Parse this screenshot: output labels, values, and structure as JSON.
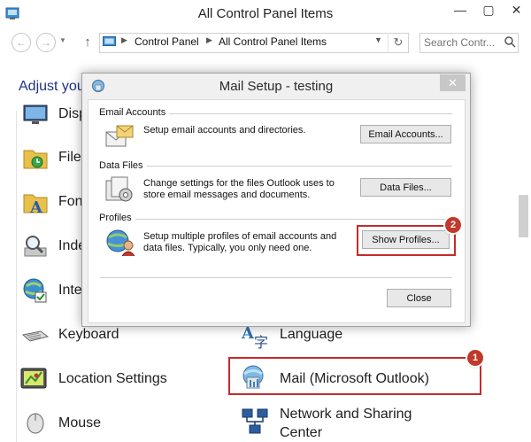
{
  "window": {
    "title": "All Control Panel Items"
  },
  "address": {
    "crumbs": [
      "Control Panel",
      "All Control Panel Items"
    ],
    "search_placeholder": "Search Contr..."
  },
  "main": {
    "heading": "Adjust you",
    "items_left": [
      {
        "label": "Disp",
        "icon": "display-icon"
      },
      {
        "label": "File",
        "icon": "file-history-icon"
      },
      {
        "label": "Fon",
        "icon": "fonts-icon"
      },
      {
        "label": "Inde",
        "icon": "indexing-icon"
      },
      {
        "label": "Inte",
        "icon": "internet-options-icon"
      },
      {
        "label": "Keyboard",
        "icon": "keyboard-icon"
      },
      {
        "label": "Location Settings",
        "icon": "location-icon"
      },
      {
        "label": "Mouse",
        "icon": "mouse-icon"
      }
    ],
    "items_right": [
      {
        "label": "Language",
        "icon": "language-icon"
      },
      {
        "label": "Mail (Microsoft Outlook)",
        "icon": "mail-icon"
      },
      {
        "label": "Network and Sharing",
        "label2": "Center",
        "icon": "network-icon"
      }
    ]
  },
  "dialog": {
    "title": "Mail Setup - testing",
    "close": "✕",
    "sections": {
      "email": {
        "label": "Email Accounts",
        "desc": "Setup email accounts and directories.",
        "button": "Email Accounts..."
      },
      "data": {
        "label": "Data Files",
        "desc1": "Change settings for the files Outlook uses to",
        "desc2": "store email messages and documents.",
        "button": "Data Files..."
      },
      "profiles": {
        "label": "Profiles",
        "desc1": "Setup multiple profiles of email accounts and",
        "desc2": "data files. Typically, you only need one.",
        "button": "Show Profiles..."
      }
    },
    "close_button": "Close"
  },
  "badges": {
    "one": "1",
    "two": "2"
  },
  "colors": {
    "highlight": "#c62a2a",
    "badge": "#c0392b",
    "heading": "#1e3287"
  }
}
